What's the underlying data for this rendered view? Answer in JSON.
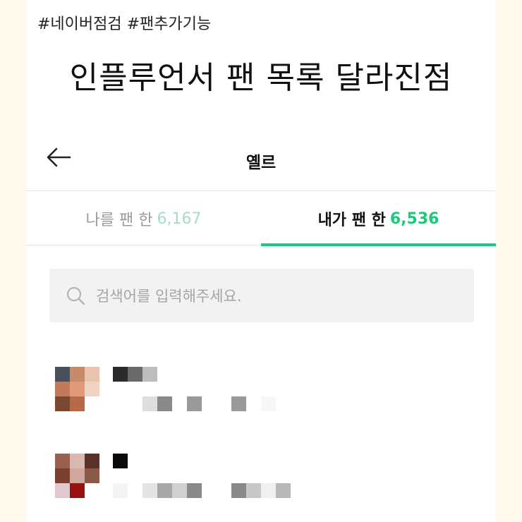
{
  "hashtags": "#네이버점검 #팬추가기능",
  "headline": "인플루언서 팬 목록 달라진점",
  "topbar": {
    "title": "옐르"
  },
  "tabs": [
    {
      "label": "나를 팬 한",
      "count": "6,167",
      "active": false
    },
    {
      "label": "내가 팬 한",
      "count": "6,536",
      "active": true
    }
  ],
  "search": {
    "placeholder": "검색어를 입력해주세요."
  },
  "colors": {
    "accent": "#1ec97a",
    "accent_light": "#a8dcc5",
    "background": "#fdf9ec"
  },
  "icons": {
    "back": "arrow-left-icon",
    "search": "magnifier-icon"
  }
}
